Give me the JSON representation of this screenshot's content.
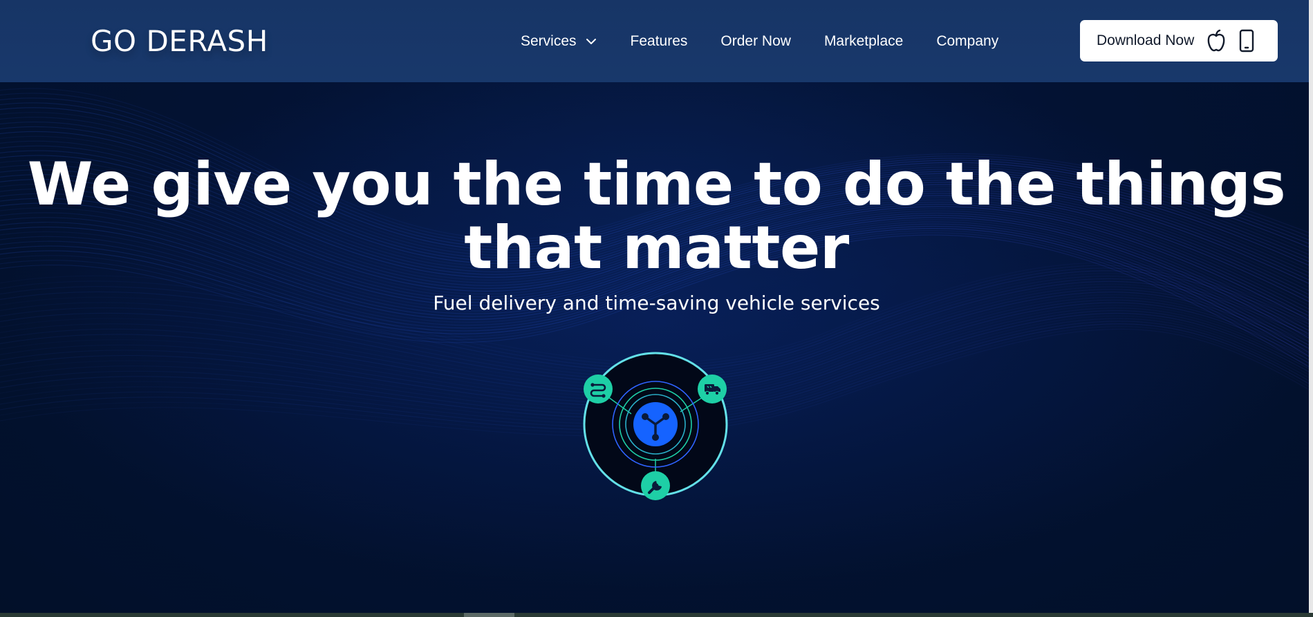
{
  "header": {
    "logo": "GO DERASH",
    "nav": {
      "services": "Services",
      "features": "Features",
      "order_now": "Order Now",
      "marketplace": "Marketplace",
      "company": "Company"
    },
    "download_label": "Download Now",
    "icons": [
      "chevron-down-icon",
      "apple-icon",
      "smartphone-icon"
    ]
  },
  "hero": {
    "title_line1": "We give you the time to do the things",
    "title_line2": "that matter",
    "subtitle": "Fuel delivery and time-saving vehicle services",
    "hub_icons": [
      "route-icon",
      "delivery-truck-icon",
      "wrench-icon",
      "network-hub-icon"
    ]
  },
  "colors": {
    "header_bg": "#18386b",
    "hero_bg": "#031233",
    "accent_teal": "#1ecfa6",
    "accent_blue": "#1563ff",
    "ring": "#5fe3e6"
  }
}
